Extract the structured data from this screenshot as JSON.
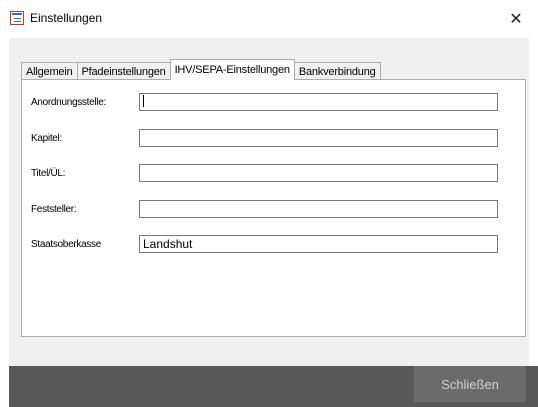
{
  "window": {
    "title": "Einstellungen",
    "close_glyph": "✕"
  },
  "tabs": [
    {
      "label": "Allgemein",
      "active": false
    },
    {
      "label": "Pfadeinstellungen",
      "active": false
    },
    {
      "label": "IHV/SEPA-Einstellungen",
      "active": true
    },
    {
      "label": "Bankverbindung",
      "active": false
    }
  ],
  "fields": [
    {
      "label": "Anordnungsstelle:",
      "value": ""
    },
    {
      "label": "Kapitel:",
      "value": ""
    },
    {
      "label": "Titel/ÜL:",
      "value": ""
    },
    {
      "label": "Feststeller:",
      "value": ""
    },
    {
      "label": "Staatsoberkasse",
      "value": "Landshut"
    }
  ],
  "footer": {
    "close_button_label": "Schließen"
  },
  "colors": {
    "footer_bg": "#585858",
    "button_bg": "#6b6b6b",
    "client_bg": "#f0f0f0"
  }
}
